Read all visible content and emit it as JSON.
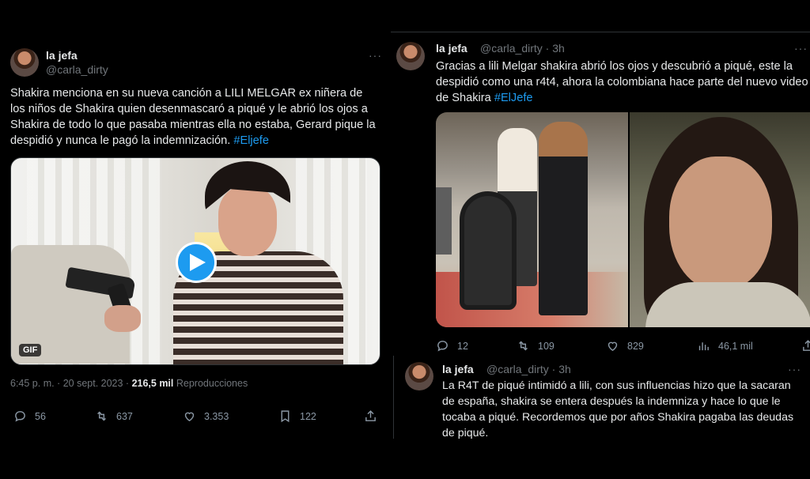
{
  "left_tweet": {
    "name": "la jefa",
    "handle": "@carla_dirty",
    "more": "···",
    "text_main": "Shakira menciona en su nueva canción a LILI MELGAR ex niñera de los niños de Shakira quien desenmascaró a piqué y le abrió los ojos a Shakira de todo lo que pasaba mientras ella no estaba, Gerard pique la despidió y nunca le pagó la indemnización. ",
    "hashtag": "#Eljefe",
    "gif_badge": "GIF",
    "time": "6:45 p. m. · 20 sept. 2023 · ",
    "views_count": "216,5 mil",
    "views_label": "Reproducciones",
    "actions": {
      "replies": "56",
      "retweets": "637",
      "likes": "3.353",
      "bookmarks": "122"
    }
  },
  "right_tweet": {
    "name": "la jefa",
    "handle": "@carla_dirty · 3h",
    "more": "···",
    "text_main": "Gracias a lili Melgar shakira abrió los ojos y descubrió a piqué, este la despidió como una r4t4, ahora la colombiana hace parte del nuevo video de Shakira ",
    "hashtag": "#ElJefe",
    "actions": {
      "replies": "12",
      "retweets": "109",
      "likes": "829",
      "views": "46,1 mil"
    }
  },
  "reply_tweet": {
    "name": "la jefa",
    "handle": "@carla_dirty · 3h",
    "more": "···",
    "text": "La R4T de piqué intimidó a lili, con sus influencias hizo que la sacaran de españa, shakira se entera después la indemniza y hace lo que le tocaba a piqué. Recordemos que por años Shakira pagaba las deudas de piqué."
  },
  "icons": {
    "reply": "reply-icon",
    "retweet": "retweet-icon",
    "like": "heart-icon",
    "bookmark": "bookmark-icon",
    "share": "share-icon",
    "views": "views-chart-icon",
    "play": "play-icon"
  },
  "colors": {
    "background": "#000000",
    "text": "#e7e9ea",
    "muted": "#71767b",
    "accent": "#1d9bf0"
  }
}
